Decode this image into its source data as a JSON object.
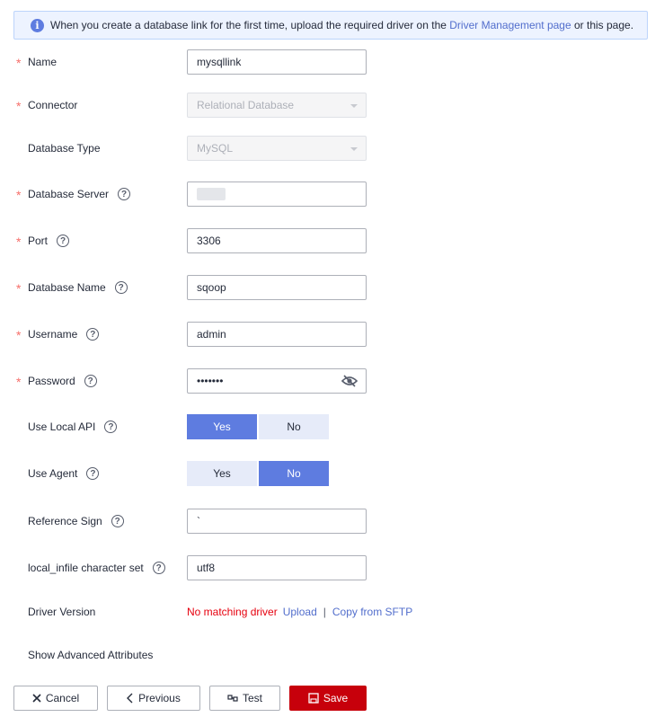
{
  "banner": {
    "icon": "info-icon",
    "text_before": "When you create a database link for the first time, upload the required driver on the ",
    "link": "Driver Management page",
    "text_after": " or this page."
  },
  "required_mark": "*",
  "fields": {
    "name": {
      "label": "Name",
      "value": "mysqllink"
    },
    "connector": {
      "label": "Connector",
      "value": "Relational Database"
    },
    "database_type": {
      "label": "Database Type",
      "value": "MySQL"
    },
    "database_server": {
      "label": "Database Server",
      "value": ""
    },
    "port": {
      "label": "Port",
      "value": "3306"
    },
    "database_name": {
      "label": "Database Name",
      "value": "sqoop"
    },
    "username": {
      "label": "Username",
      "value": "admin"
    },
    "password": {
      "label": "Password",
      "value": "•••••••"
    },
    "use_local_api": {
      "label": "Use Local API",
      "options": [
        "Yes",
        "No"
      ],
      "selected": "Yes"
    },
    "use_agent": {
      "label": "Use Agent",
      "options": [
        "Yes",
        "No"
      ],
      "selected": "No"
    },
    "reference_sign": {
      "label": "Reference Sign",
      "value": "`"
    },
    "local_infile_charset": {
      "label": "local_infile character set",
      "value": "utf8"
    },
    "driver_version": {
      "label": "Driver Version",
      "status": "No matching driver",
      "upload_link": "Upload",
      "separator": "|",
      "sftp_link": "Copy from SFTP"
    }
  },
  "help_glyph": "?",
  "advanced_link": "Show Advanced Attributes",
  "footer": {
    "cancel": "Cancel",
    "previous": "Previous",
    "test": "Test",
    "save": "Save"
  },
  "colors": {
    "accent": "#5e7ce0",
    "link": "#526ecc",
    "required": "#f66f6a",
    "error": "#e6000e",
    "save": "#c7000b"
  }
}
